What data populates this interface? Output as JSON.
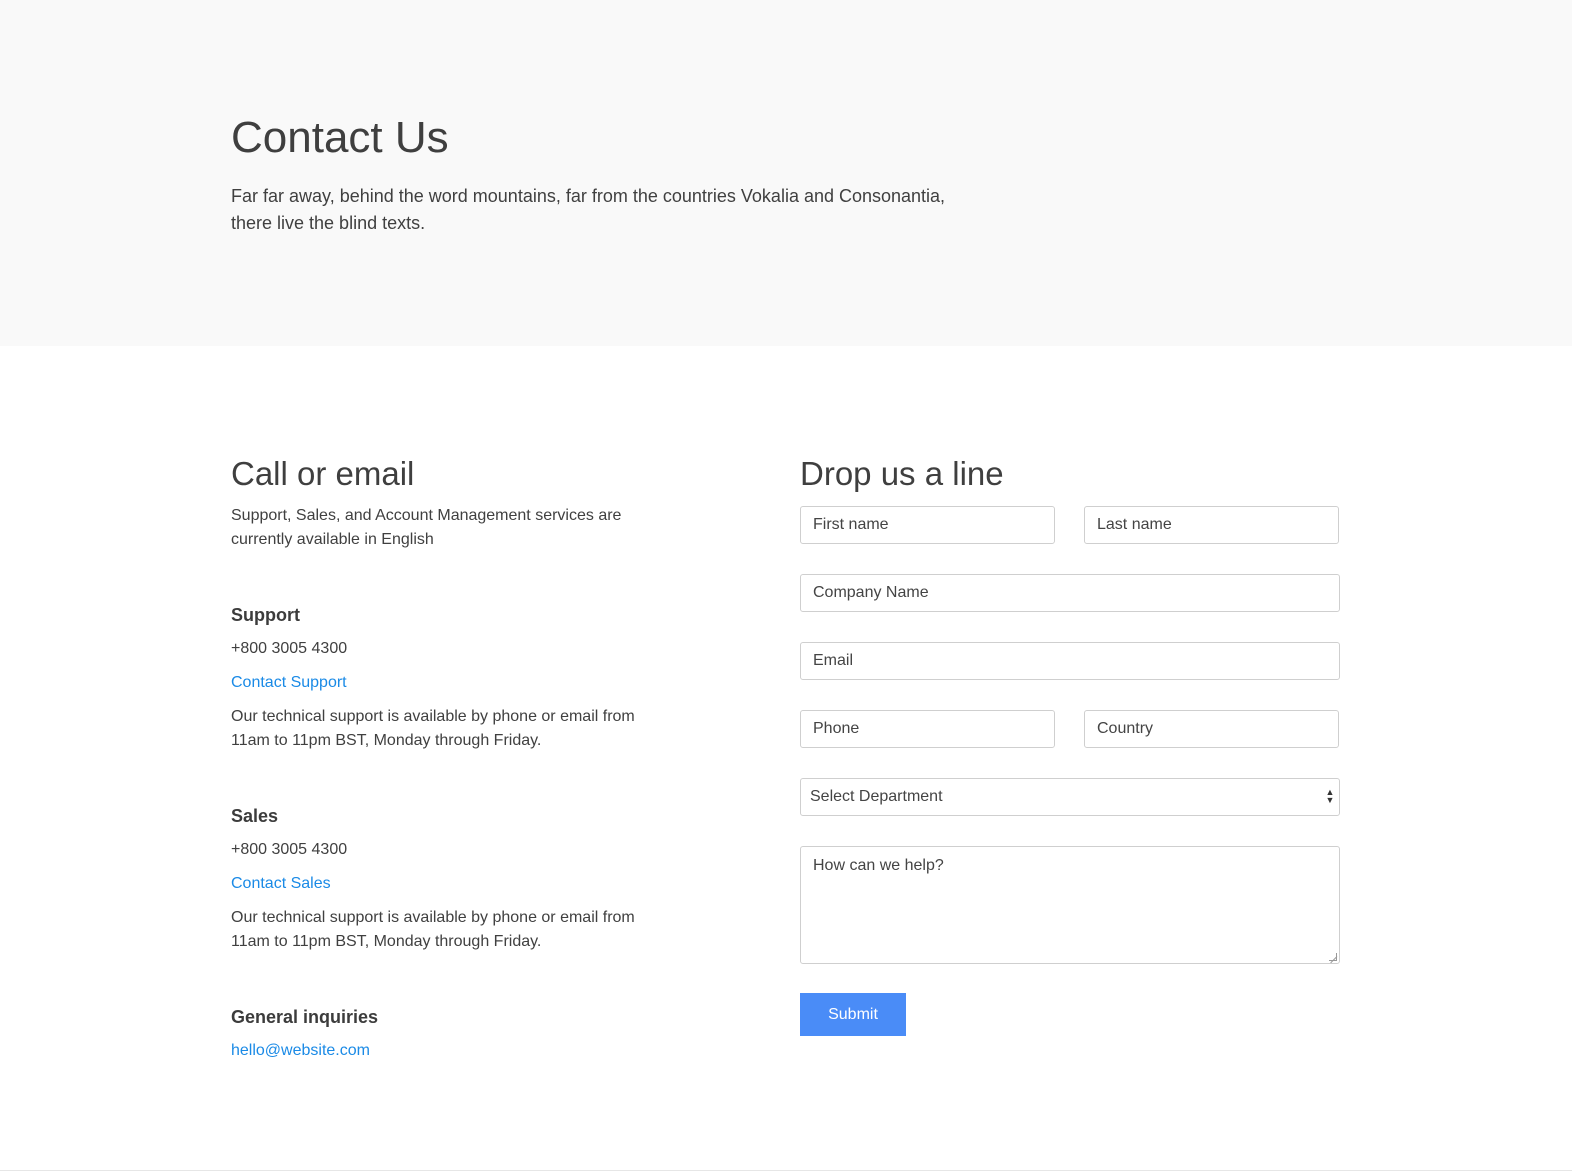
{
  "hero": {
    "title": "Contact Us",
    "text": "Far far away, behind the word mountains, far from the countries Vokalia and Consonantia, there live the blind texts."
  },
  "contact_info": {
    "title": "Call or email",
    "intro": "Support, Sales, and Account Management services are currently available in English",
    "support": {
      "title": "Support",
      "phone": "+800 3005 4300",
      "link": "Contact Support",
      "hours": "Our technical support is available by phone or email from 11am to 11pm BST, Monday through Friday."
    },
    "sales": {
      "title": "Sales",
      "phone": "+800 3005 4300",
      "link": "Contact Sales",
      "hours": "Our technical support is available by phone or email from 11am to 11pm BST, Monday through Friday."
    },
    "general": {
      "title": "General inquiries",
      "email": "hello@website.com"
    }
  },
  "form": {
    "title": "Drop us a line",
    "first_name_placeholder": "First name",
    "last_name_placeholder": "Last name",
    "company_placeholder": "Company Name",
    "email_placeholder": "Email",
    "phone_placeholder": "Phone",
    "country_placeholder": "Country",
    "department_selected": "Select Department",
    "message_placeholder": "How can we help?",
    "submit_label": "Submit"
  },
  "colors": {
    "hero_background": "#f9f9f9",
    "link": "#1a8ae6",
    "button": "#4a8cf7"
  },
  "icons": {
    "select_arrows": "select-arrows-icon",
    "resize": "resize-grip-icon"
  }
}
